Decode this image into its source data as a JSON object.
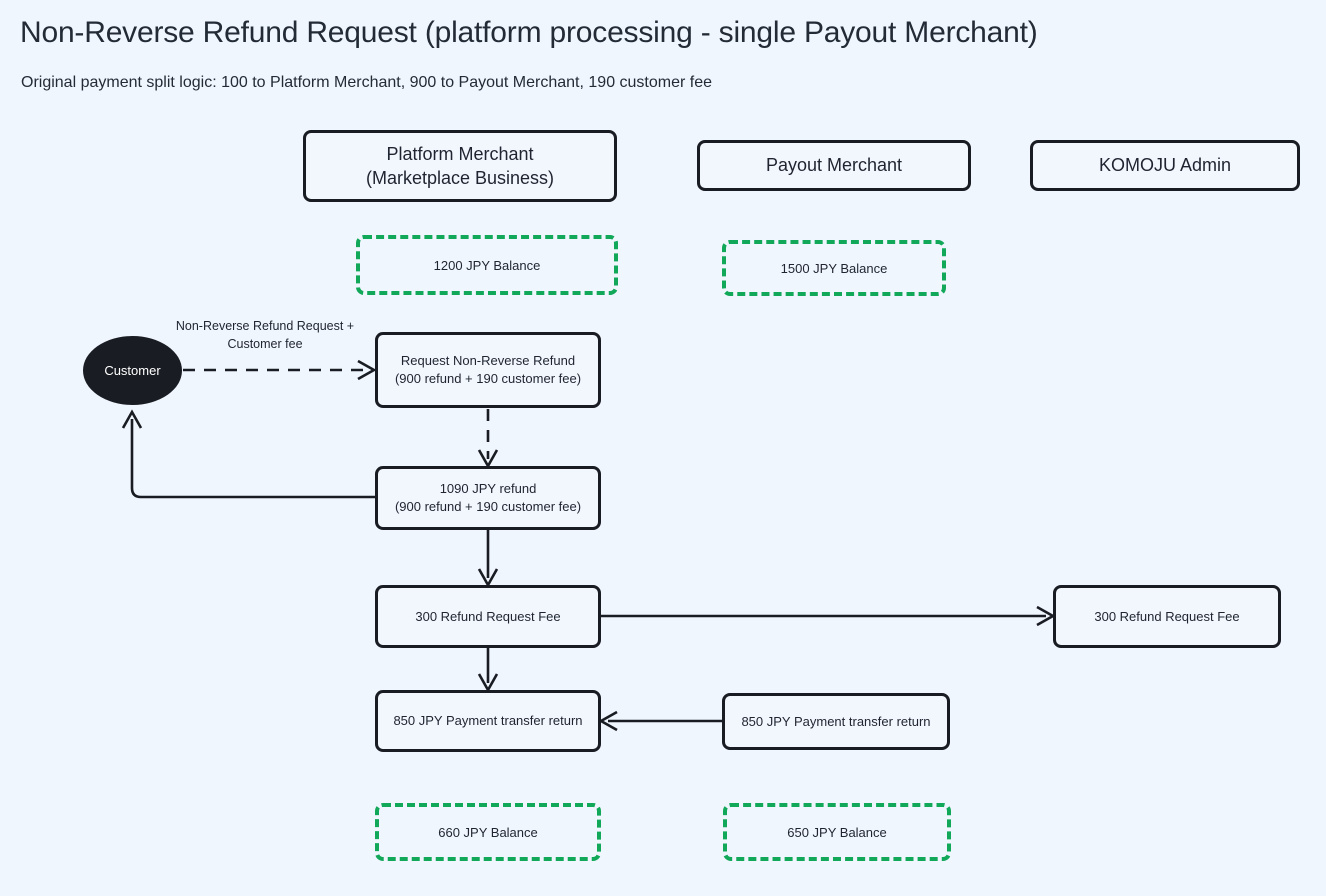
{
  "header": {
    "title": "Non-Reverse Refund Request (platform processing - single Payout Merchant)",
    "subtitle": "Original payment split logic: 100 to Platform Merchant, 900 to Payout Merchant, 190 customer fee"
  },
  "colors": {
    "background": "#f0f6fe",
    "node_border": "#191c22",
    "node_fill": "#f2f7fe",
    "balance_green": "#12a85a",
    "text": "#1f2430",
    "customer_fill": "#191c22",
    "customer_text": "#ffffff"
  },
  "actors": [
    {
      "id": "platform-merchant",
      "line1": "Platform Merchant",
      "line2": "(Marketplace Business)"
    },
    {
      "id": "payout-merchant",
      "line1": "Payout Merchant",
      "line2": ""
    },
    {
      "id": "komoju-admin",
      "line1": "KOMOJU Admin",
      "line2": ""
    }
  ],
  "balances_top": [
    {
      "id": "platform-balance-before",
      "label": "1200 JPY Balance"
    },
    {
      "id": "payout-balance-before",
      "label": "1500 JPY Balance"
    }
  ],
  "balances_bottom": [
    {
      "id": "platform-balance-after",
      "label": "660 JPY Balance"
    },
    {
      "id": "payout-balance-after",
      "label": "650 JPY Balance"
    }
  ],
  "customer": {
    "label": "Customer"
  },
  "nodes": {
    "request_refund": {
      "line1": "Request Non-Reverse Refund",
      "line2": "(900 refund + 190 customer fee)"
    },
    "refund_amount": {
      "line1": "1090 JPY refund",
      "line2": "(900 refund + 190 customer fee)"
    },
    "platform_fee": {
      "label": "300 Refund Request Fee"
    },
    "admin_fee": {
      "label": "300 Refund Request Fee"
    },
    "platform_transfer_return": {
      "label": "850 JPY Payment transfer return"
    },
    "payout_transfer_return": {
      "label": "850 JPY Payment transfer return"
    }
  },
  "edges": [
    {
      "id": "customer-to-request",
      "label_line1": "Non-Reverse Refund Request +",
      "label_line2": "Customer fee",
      "style": "dashed"
    },
    {
      "id": "request-to-refund",
      "label_line1": "",
      "label_line2": "",
      "style": "dashed"
    },
    {
      "id": "refund-to-customer",
      "label_line1": "",
      "label_line2": "",
      "style": "solid"
    },
    {
      "id": "refund-to-platform-fee",
      "label_line1": "",
      "label_line2": "",
      "style": "solid"
    },
    {
      "id": "platform-fee-to-admin-fee",
      "label_line1": "",
      "label_line2": "",
      "style": "solid"
    },
    {
      "id": "platform-fee-to-transfer-return",
      "label_line1": "",
      "label_line2": "",
      "style": "solid"
    },
    {
      "id": "payout-return-to-platform-return",
      "label_line1": "",
      "label_line2": "",
      "style": "solid"
    }
  ]
}
